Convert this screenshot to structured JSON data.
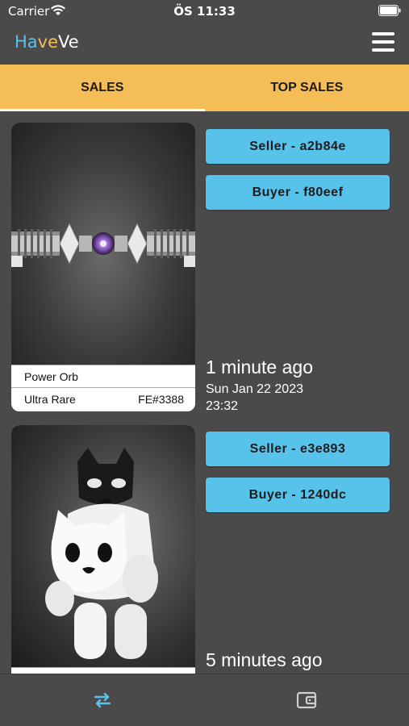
{
  "status_bar": {
    "carrier": "Carrier",
    "time": "ÖS 11:33"
  },
  "header": {
    "logo_parts": [
      {
        "text": "Ha",
        "color": "#5bc0eb"
      },
      {
        "text": "ve",
        "color": "#f4bd55"
      },
      {
        "text": "Ve",
        "color": "#ffffff"
      }
    ]
  },
  "tabs": [
    {
      "label": "SALES",
      "active": true
    },
    {
      "label": "TOP SALES",
      "active": false
    }
  ],
  "sales": [
    {
      "item_name": "Power Orb",
      "rarity": "Ultra Rare",
      "serial": "FE#3388",
      "seller_label": "Seller - a2b84e",
      "buyer_label": "Buyer - f80eef",
      "time_ago": "1 minute ago",
      "date": "Sun Jan 22 2023",
      "time": "23:32"
    },
    {
      "item_name": "",
      "rarity": "",
      "serial": "",
      "seller_label": "Seller - e3e893",
      "buyer_label": "Buyer - 1240dc",
      "time_ago": "5 minutes ago"
    }
  ],
  "bottom_nav": [
    {
      "icon": "swap-arrows-icon",
      "active": true,
      "color": "#5bc0eb"
    },
    {
      "icon": "wallet-icon",
      "active": false,
      "color": "#cfcfcf"
    }
  ],
  "colors": {
    "accent_yellow": "#f4bd55",
    "accent_blue": "#57c3ea",
    "background": "#4a4a4a"
  }
}
